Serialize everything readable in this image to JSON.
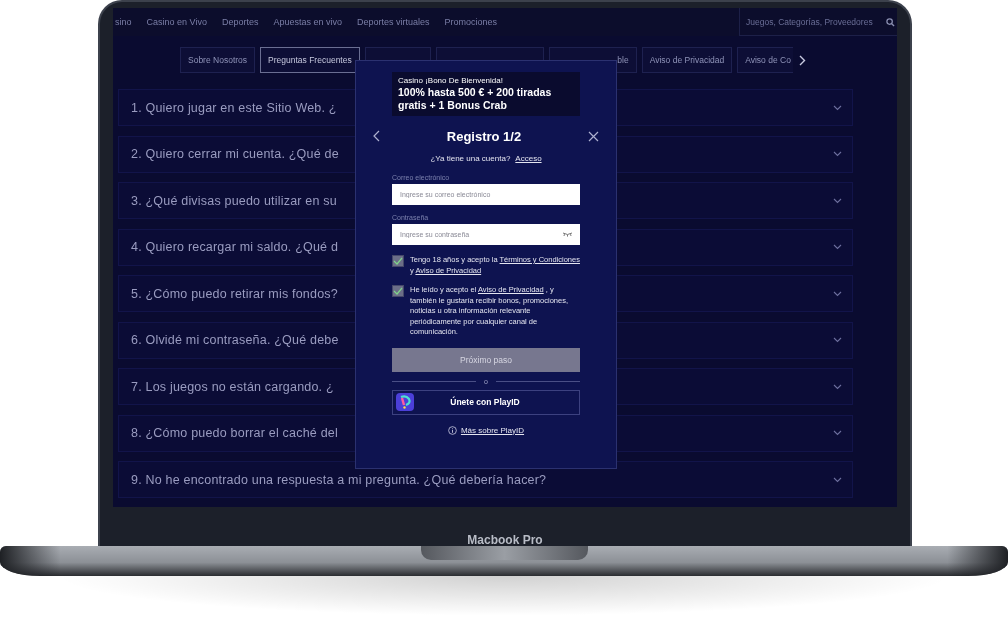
{
  "laptop": {
    "label": "Macbook Pro"
  },
  "nav": {
    "items": [
      "sino",
      "Casino en Vivo",
      "Deportes",
      "Apuestas en vivo",
      "Deportes virtuales",
      "Promociones"
    ],
    "search": {
      "placeholder": "Juegos, Categorías, Proveedores"
    }
  },
  "tabs": [
    {
      "label": "Sobre Nosotros",
      "selected": false
    },
    {
      "label": "Preguntas Frecuentes",
      "selected": true
    },
    {
      "selected": false
    },
    {
      "selected": false
    },
    {
      "label": "ble",
      "selected": false
    },
    {
      "label": "Aviso de Privacidad",
      "selected": false
    },
    {
      "label": "Aviso de Co",
      "selected": false
    }
  ],
  "faq": [
    {
      "question": "1. Quiero jugar en este Sitio Web. ¿",
      "expanded": false
    },
    {
      "question": "2. Quiero cerrar mi cuenta. ¿Qué de",
      "expanded": false
    },
    {
      "question": "3. ¿Qué divisas puedo utilizar en su",
      "expanded": false
    },
    {
      "question": "4. Quiero recargar mi saldo. ¿Qué d",
      "expanded": false
    },
    {
      "question": "5. ¿Cómo puedo retirar mis fondos?",
      "expanded": false
    },
    {
      "question": "6. Olvidé mi contraseña. ¿Qué debe",
      "expanded": false
    },
    {
      "question": "7. Los juegos no están cargando. ¿",
      "expanded": false
    },
    {
      "question": "8. ¿Cómo puedo borrar el caché del",
      "expanded": false
    },
    {
      "question": "9. No he encontrado una respuesta a mi pregunta. ¿Qué debería hacer?",
      "expanded": false
    }
  ],
  "modal": {
    "banner": {
      "kicker": "Casino ¡Bono De Bienvenida!",
      "headline": "100% hasta 500 € + 200 tiradas gratis + 1 Bonus Crab"
    },
    "title": "Registro 1/2",
    "login_prompt": {
      "text": "¿Ya tiene una cuenta?",
      "link": "Acceso"
    },
    "fields": [
      {
        "label": "Correo electrónico",
        "placeholder": "Ingrese su correo electrónico",
        "kind": "text"
      },
      {
        "label": "Contraseña",
        "placeholder": "Ingrese su contraseña",
        "kind": "password"
      }
    ],
    "consents": [
      {
        "checked": true,
        "parts": [
          {
            "text": "Tengo 18 años y acepto la "
          },
          {
            "text": "Términos y Condiciones",
            "link": true
          },
          {
            "text": " y "
          },
          {
            "text": "Aviso de Privacidad",
            "link": true
          }
        ]
      },
      {
        "checked": true,
        "parts": [
          {
            "text": "He leído y acepto el "
          },
          {
            "text": "Aviso de Privacidad",
            "link": true
          },
          {
            "text": " , y también le gustaría recibir bonos, promociones, noticias u otra información relevante periódicamente por cualquier canal de comunicación."
          }
        ]
      }
    ],
    "next_button": {
      "label": "Próximo paso",
      "disabled": true
    },
    "divider": "o",
    "playid_button": "Únete con PlayID",
    "playid_link": "Más sobre PlayID"
  }
}
